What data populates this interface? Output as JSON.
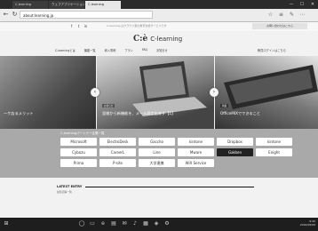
{
  "browser": {
    "tabs": [
      {
        "label": "C-learning"
      },
      {
        "label": "ウェブアプリケーション"
      },
      {
        "label": "C-learning"
      }
    ],
    "url": "about:learning.jp",
    "window_buttons": [
      "—",
      "☐",
      "✕"
    ],
    "nav_icons": {
      "back": "←",
      "forward": "→",
      "refresh": "↻"
    },
    "toolbar_icons": [
      "☆",
      "≡",
      "✎",
      "⋯"
    ]
  },
  "site": {
    "topbar": {
      "social_icons": [
        "f",
        "t",
        "in"
      ],
      "tagline": "C-learning はクラウド型の教育支援サービスです",
      "contact_label": "お問い合わせはこちら"
    },
    "logo": {
      "mark": "C:è",
      "text": "C-learning"
    },
    "nav": [
      "C-learningとは",
      "機能一覧",
      "導入事例",
      "プラン",
      "FAQ",
      "お知らせ"
    ],
    "login_label": "教員ログインはこちら",
    "slides": [
      {
        "label": "ーケ店るメリット",
        "tag": ""
      },
      {
        "label": "混雑から新機能を、メール設定出来す【1】",
        "tag": "お知らせ"
      },
      {
        "label": "OfficeMIXでできること",
        "tag": "特集"
      }
    ],
    "partners": {
      "heading": "C-learningパートナー企業一覧",
      "logos": [
        "Microsoft",
        "ElectroDesk",
        "Gaccho",
        "kintone",
        "Dropbox",
        "kintone",
        "Cybozu",
        "CareerL",
        "Line",
        "Mware",
        "Gakken",
        "Enight",
        "Prima",
        "P-site",
        "大学連携",
        "WiX Service"
      ]
    },
    "latest": {
      "heading": "LATEST ENTRY",
      "sub": "最新記事一覧"
    }
  },
  "taskbar": {
    "icons": [
      "⊞",
      "◯",
      "▭",
      "e",
      "▤",
      "✉",
      "♪",
      "▦",
      "◈",
      "⚙"
    ],
    "time": "9:40",
    "date": "2016/06/06"
  }
}
